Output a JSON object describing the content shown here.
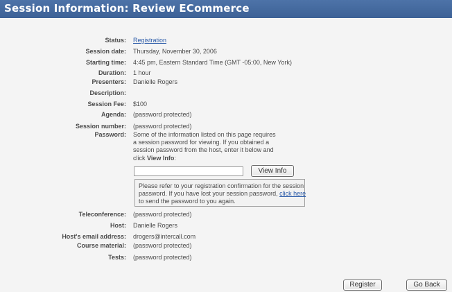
{
  "header": {
    "title": "Session Information: Review ECommerce"
  },
  "fields": {
    "status": {
      "label": "Status:",
      "value": "Registration"
    },
    "session_date": {
      "label": "Session date:",
      "value": "Thursday, November 30, 2006"
    },
    "starting_time": {
      "label": "Starting time:",
      "value": "4:45 pm, Eastern Standard Time (GMT -05:00, New York)"
    },
    "duration": {
      "label": "Duration:",
      "value": "1 hour"
    },
    "presenters": {
      "label": "Presenters:",
      "value": "Danielle Rogers"
    },
    "description": {
      "label": "Description:",
      "value": ""
    },
    "session_fee": {
      "label": "Session Fee:",
      "value": "$100"
    },
    "agenda": {
      "label": "Agenda:",
      "value": "(password protected)"
    },
    "session_number": {
      "label": "Session number:",
      "value": "(password protected)"
    },
    "password": {
      "label": "Password:",
      "instructions": [
        "Some of the information listed on this page requires",
        "a session password for viewing. If you obtained a",
        "session password from the host, enter it below and"
      ],
      "instructions_last_prefix": "click ",
      "instructions_last_bold": "View Info",
      "instructions_last_suffix": ":",
      "input_value": "",
      "view_info_button": "View Info",
      "notice_line1": "Please refer to your registration confirmation for the session",
      "notice_line2_prefix": "password. If you have lost your session password, ",
      "notice_link": "click here",
      "notice_line3": "to send the password to you again."
    },
    "teleconference": {
      "label": "Teleconference:",
      "value": "(password protected)"
    },
    "host": {
      "label": "Host:",
      "value": "Danielle Rogers"
    },
    "host_email": {
      "label": "Host's email address:",
      "value": "drogers@intercall.com"
    },
    "course_material": {
      "label": "Course material:",
      "value": "(password protected)"
    },
    "tests": {
      "label": "Tests:",
      "value": "(password protected)"
    }
  },
  "actions": {
    "register": "Register",
    "go_back": "Go Back"
  },
  "colors": {
    "header_bg": "#4067a0",
    "link": "#2a5aa8",
    "page_bg": "#f4f4f4"
  }
}
